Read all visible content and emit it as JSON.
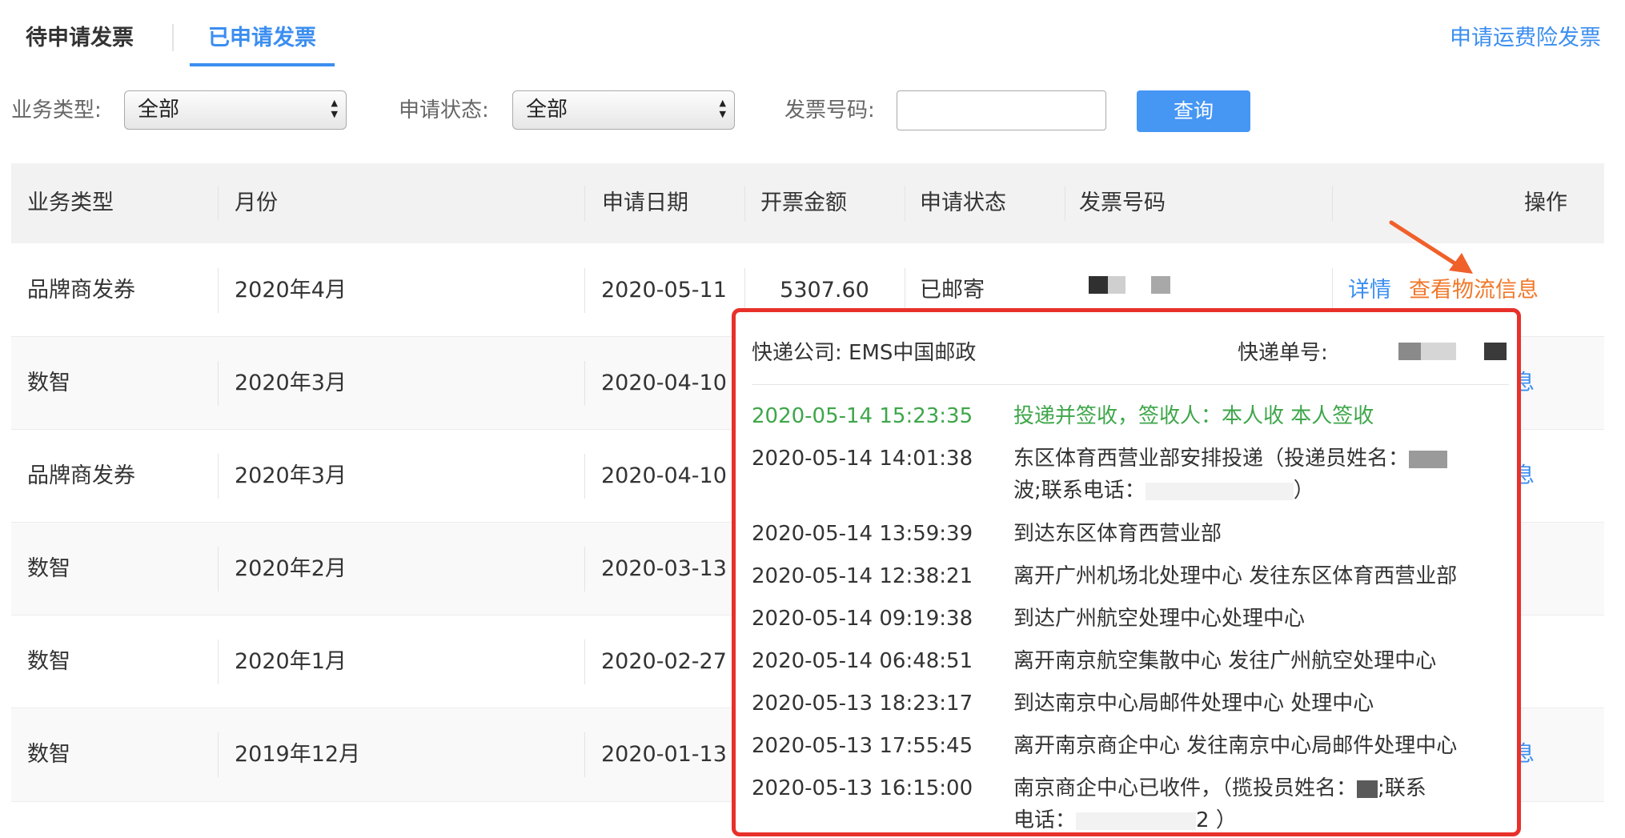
{
  "tabs": {
    "pending": "待申请发票",
    "applied": "已申请发票"
  },
  "header": {
    "apply_link": "申请运费险发票"
  },
  "filters": {
    "business_type_label": "业务类型:",
    "business_type_value": "全部",
    "status_label": "申请状态:",
    "status_value": "全部",
    "invoice_no_label": "发票号码:",
    "invoice_no_value": "",
    "query_button": "查询"
  },
  "table": {
    "columns": [
      "业务类型",
      "月份",
      "申请日期",
      "开票金额",
      "申请状态",
      "发票号码",
      "操作"
    ],
    "rows": [
      {
        "business": "品牌商发券",
        "month": "2020年4月",
        "date": "2020-05-11",
        "amount": "5307.60",
        "status": "已邮寄",
        "detail": "详情",
        "logistics": "查看物流信息"
      },
      {
        "business": "数智",
        "month": "2020年3月",
        "date": "2020-04-10",
        "partial_op": "息"
      },
      {
        "business": "品牌商发券",
        "month": "2020年3月",
        "date": "2020-04-10",
        "partial_op": "息"
      },
      {
        "business": "数智",
        "month": "2020年2月",
        "date": "2020-03-13"
      },
      {
        "business": "数智",
        "month": "2020年1月",
        "date": "2020-02-27"
      },
      {
        "business": "数智",
        "month": "2019年12月",
        "date": "2020-01-13",
        "partial_op": "息"
      }
    ]
  },
  "logistics_popup": {
    "company_label": "快递公司: EMS中国邮政",
    "tracking_label": "快递单号:",
    "events": [
      {
        "time": "2020-05-14 15:23:35",
        "desc": "投递并签收，签收人：本人收 本人签收",
        "latest": true
      },
      {
        "time": "2020-05-14 14:01:38",
        "desc": "东区体育西营业部安排投递（投递员姓名：",
        "desc2": "波;联系电话：",
        "desc3": "）"
      },
      {
        "time": "2020-05-14 13:59:39",
        "desc": "到达东区体育西营业部"
      },
      {
        "time": "2020-05-14 12:38:21",
        "desc": "离开广州机场北处理中心 发往东区体育西营业部"
      },
      {
        "time": "2020-05-14 09:19:38",
        "desc": "到达广州航空处理中心处理中心"
      },
      {
        "time": "2020-05-14 06:48:51",
        "desc": "离开南京航空集散中心 发往广州航空处理中心"
      },
      {
        "time": "2020-05-13 18:23:17",
        "desc": "到达南京中心局邮件处理中心 处理中心"
      },
      {
        "time": "2020-05-13 17:55:45",
        "desc": "离开南京商企中心 发往南京中心局邮件处理中心"
      },
      {
        "time": "2020-05-13 16:15:00",
        "desc": "南京商企中心已收件，（揽投员姓名：",
        "desc2": ";联系",
        "desc3": "电话：",
        "desc4": "2 ）"
      }
    ]
  },
  "colors": {
    "accent": "#3b8ef0",
    "logistics_link": "#f0782a",
    "popup_border": "#e8302a",
    "latest_event": "#3ea64a"
  }
}
